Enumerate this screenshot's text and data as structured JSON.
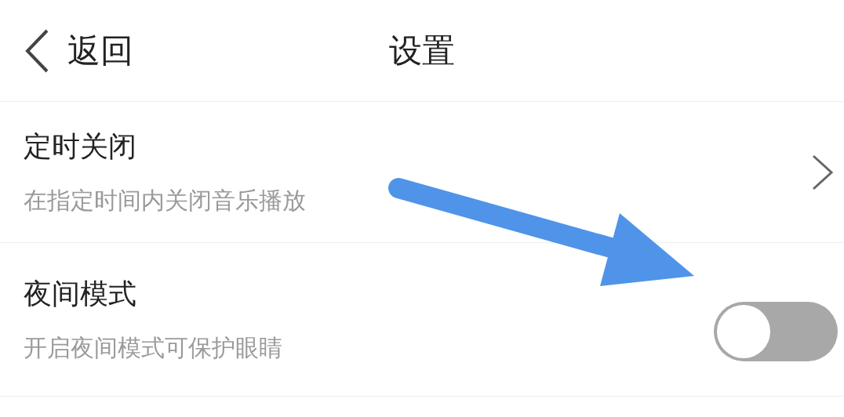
{
  "header": {
    "back_label": "返回",
    "title": "设置"
  },
  "settings": [
    {
      "kind": "link",
      "title": "定时关闭",
      "subtitle": "在指定时间内关闭音乐播放"
    },
    {
      "kind": "toggle",
      "title": "夜间模式",
      "subtitle": "开启夜间模式可保护眼睛",
      "on": false
    }
  ]
}
